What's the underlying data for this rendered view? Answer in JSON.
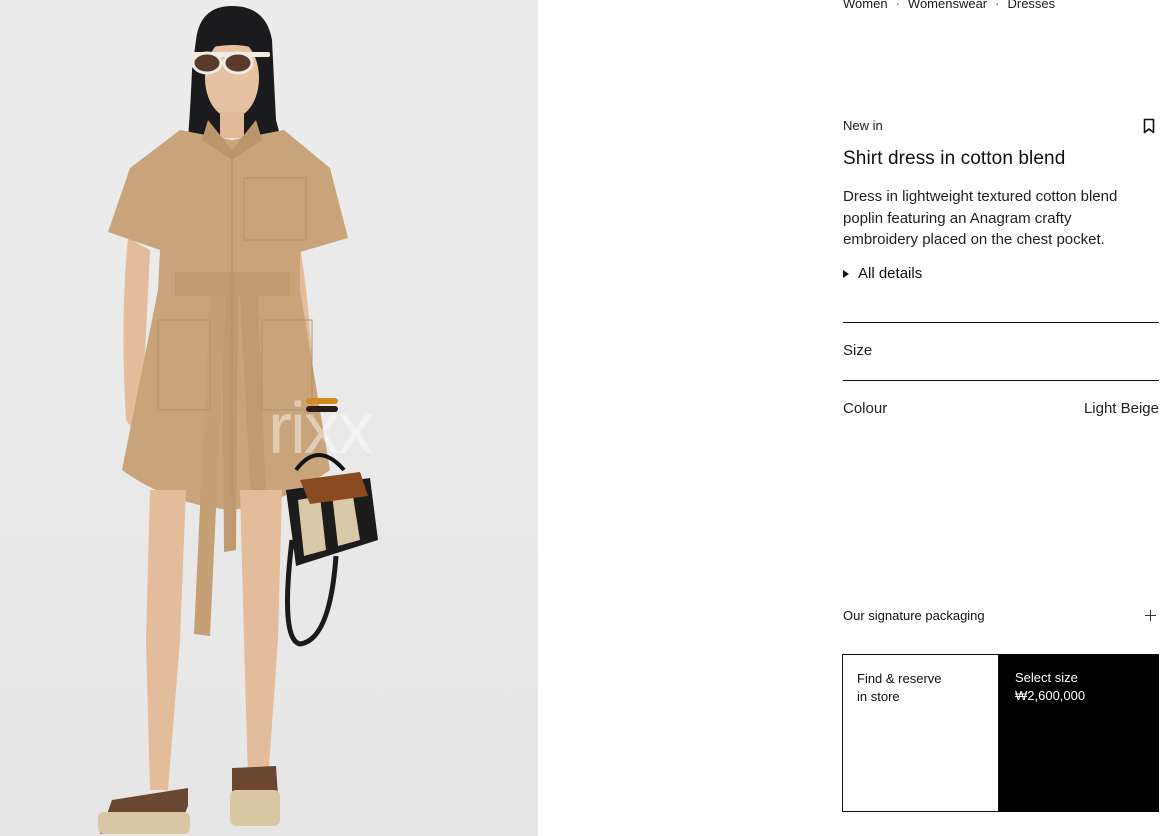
{
  "breadcrumb": {
    "items": [
      "Women",
      "Womenswear",
      "Dresses"
    ],
    "separator": "·"
  },
  "product": {
    "badge": "New in",
    "title": "Shirt dress in cotton blend",
    "description": "Dress in lightweight textured cotton blend poplin featuring an Anagram crafty embroidery placed on the chest pocket.",
    "details_label": "All details"
  },
  "options": {
    "size_label": "Size",
    "colour_label": "Colour",
    "colour_value": "Light Beige"
  },
  "packaging": {
    "label": "Our signature packaging"
  },
  "actions": {
    "store_line1": "Find & reserve",
    "store_line2": "in store",
    "size_line": "Select size",
    "price": "₩2,600,000"
  },
  "image": {
    "watermark": "rixx",
    "dress_color": "#c9a47a",
    "background_color": "#ebebeb"
  },
  "icons": {
    "bookmark": "bookmark-icon",
    "details": "triangle-right-icon",
    "packaging": "plus-icon"
  }
}
